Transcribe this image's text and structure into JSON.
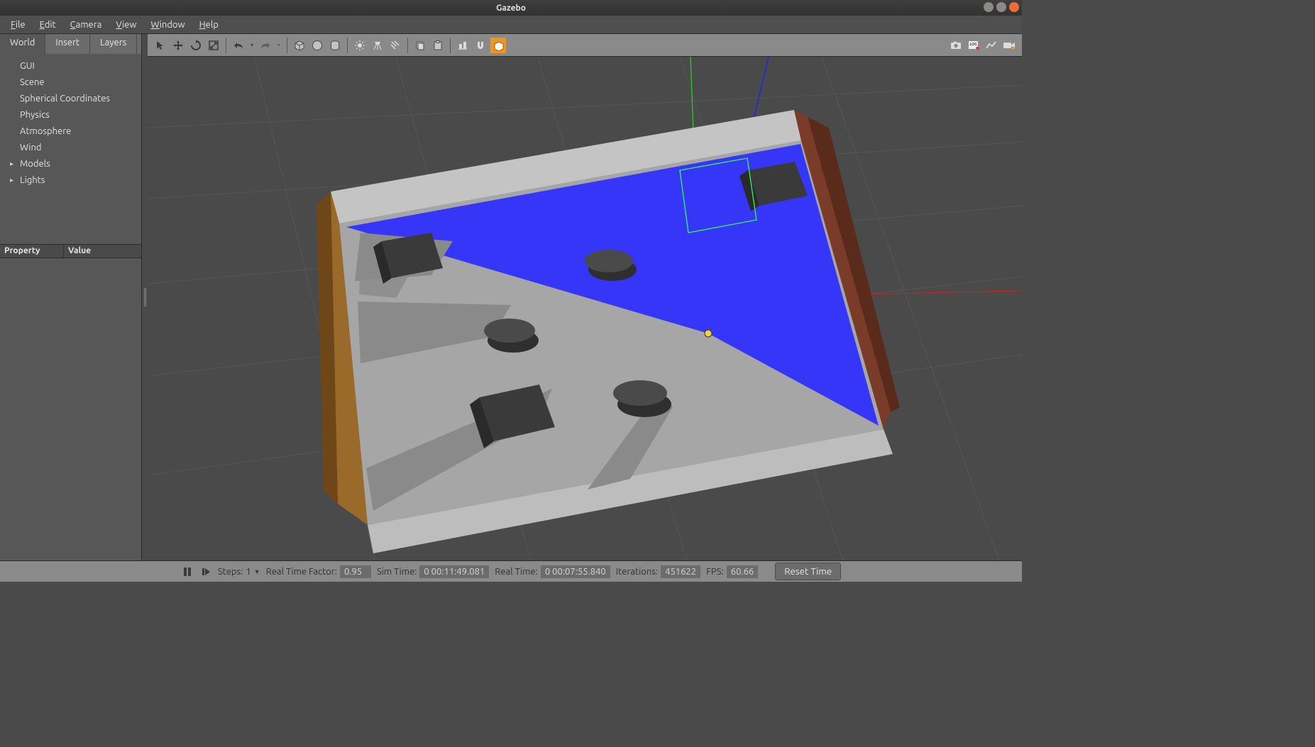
{
  "window": {
    "title": "Gazebo"
  },
  "menubar": {
    "file": "File",
    "edit": "Edit",
    "camera": "Camera",
    "view": "View",
    "window": "Window",
    "help": "Help"
  },
  "left_tabs": {
    "world": "World",
    "insert": "Insert",
    "layers": "Layers",
    "active": "World"
  },
  "tree": {
    "items": [
      {
        "label": "GUI",
        "expandable": false
      },
      {
        "label": "Scene",
        "expandable": false
      },
      {
        "label": "Spherical Coordinates",
        "expandable": false
      },
      {
        "label": "Physics",
        "expandable": false
      },
      {
        "label": "Atmosphere",
        "expandable": false
      },
      {
        "label": "Wind",
        "expandable": false
      },
      {
        "label": "Models",
        "expandable": true
      },
      {
        "label": "Lights",
        "expandable": true
      }
    ]
  },
  "property_panel": {
    "columns": [
      "Property",
      "Value"
    ]
  },
  "toolbar_icons": {
    "select": "select-arrow-icon",
    "translate": "translate-icon",
    "rotate": "rotate-icon",
    "scale": "scale-icon",
    "undo": "undo-icon",
    "redo": "redo-icon",
    "box": "box-primitive-icon",
    "sphere": "sphere-primitive-icon",
    "cylinder": "cylinder-primitive-icon",
    "point_light": "point-light-icon",
    "spot_light": "spot-light-icon",
    "directional_light": "directional-light-icon",
    "copy": "copy-icon",
    "paste": "paste-icon",
    "align": "align-icon",
    "snap": "snap-icon",
    "snap_magnet": "snap-magnet-icon",
    "screenshot": "screenshot-icon",
    "log": "log-data-icon",
    "plot": "plot-icon",
    "record": "record-video-icon"
  },
  "status": {
    "steps_label": "Steps:",
    "steps_value": "1",
    "rtf_label": "Real Time Factor:",
    "rtf_value": "0.95",
    "simtime_label": "Sim Time:",
    "simtime_value": "0 00:11:49.081",
    "realtime_label": "Real Time:",
    "realtime_value": "0 00:07:55.840",
    "iter_label": "Iterations:",
    "iter_value": "451622",
    "fps_label": "FPS:",
    "fps_value": "60.66",
    "reset_label": "Reset Time"
  },
  "colors": {
    "accent_orange": "#f0951e",
    "laser_blue": "#2c2cff",
    "axis_green": "#2fbf2f",
    "axis_blue": "#2020ff",
    "axis_red": "#d02020"
  }
}
